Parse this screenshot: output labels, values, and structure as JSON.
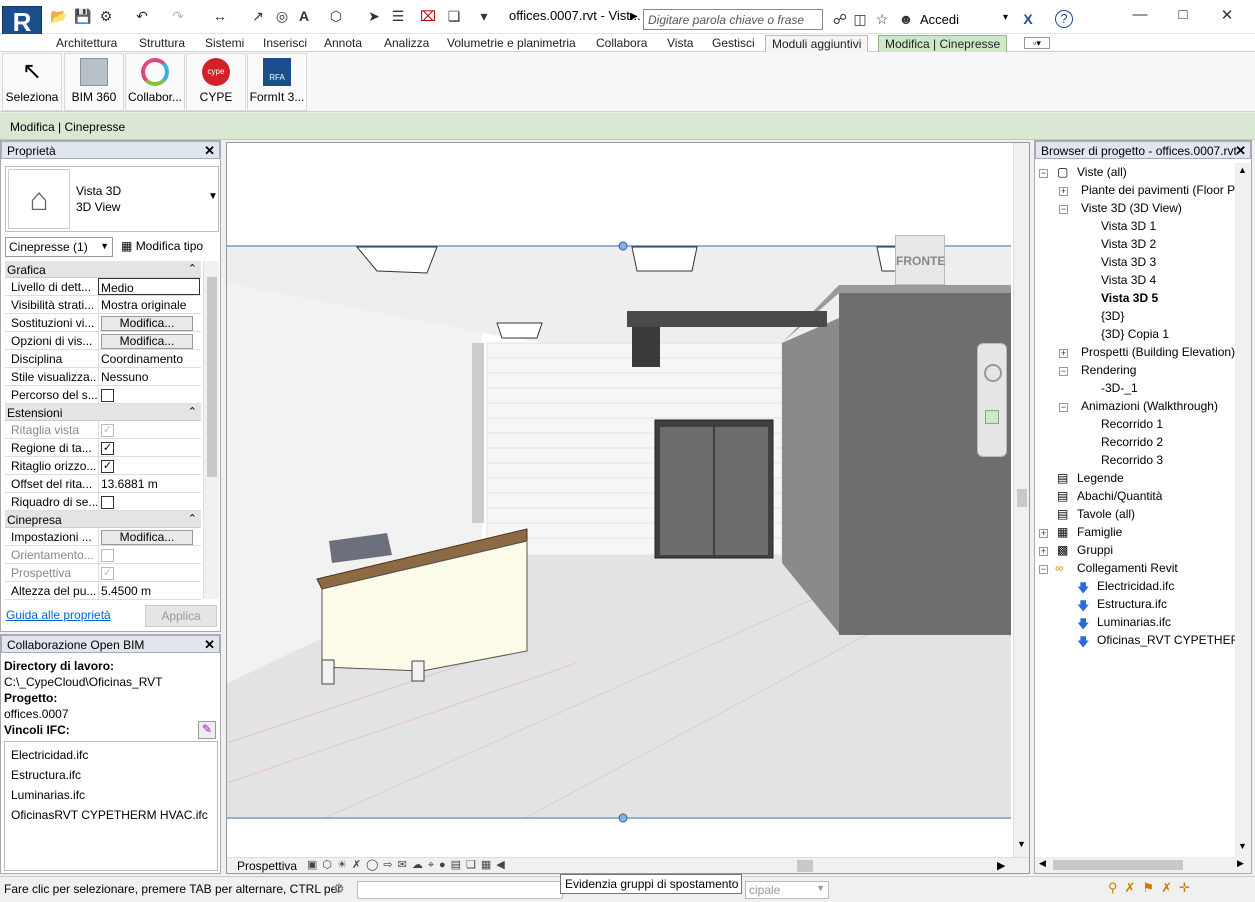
{
  "app": {
    "logo_letter": "R",
    "doc_title": "offices.0007.rvt - Vist...",
    "search_placeholder": "Digitare parola chiave o frase",
    "signin": "Accedi",
    "help": "?"
  },
  "menu": {
    "tabs": [
      "Architettura",
      "Struttura",
      "Sistemi",
      "Inserisci",
      "Annota",
      "Analizza",
      "Volumetrie e planimetria",
      "Collabora",
      "Vista",
      "Gestisci",
      "Moduli aggiuntivi",
      "Modifica | Cinepresse"
    ],
    "active": "Moduli aggiuntivi"
  },
  "ribbon": {
    "buttons": [
      "Seleziona",
      "BIM 360",
      "Collabor...",
      "CYPE",
      "FormIt 3..."
    ]
  },
  "context": {
    "label": "Modifica | Cinepresse"
  },
  "properties": {
    "title": "Proprietà",
    "type_name": "Vista 3D",
    "type_sub": "3D View",
    "selector": "Cinepresse (1)",
    "edit_type": "Modifica tipo",
    "sections": {
      "grafica": "Grafica",
      "estensioni": "Estensioni",
      "cinepresa": "Cinepresa"
    },
    "rows": {
      "livello": {
        "k": "Livello di dett...",
        "v": "Medio"
      },
      "visibilita": {
        "k": "Visibilità strati...",
        "v": "Mostra originale"
      },
      "sostituzioni": {
        "k": "Sostituzioni vi...",
        "v": "Modifica..."
      },
      "opzioni": {
        "k": "Opzioni di vis...",
        "v": "Modifica..."
      },
      "disciplina": {
        "k": "Disciplina",
        "v": "Coordinamento"
      },
      "stile": {
        "k": "Stile visualizza...",
        "v": "Nessuno"
      },
      "percorso": {
        "k": "Percorso del s..."
      },
      "ritaglia": {
        "k": "Ritaglia vista"
      },
      "regione": {
        "k": "Regione di ta..."
      },
      "ritaglio": {
        "k": "Ritaglio orizzo..."
      },
      "offset": {
        "k": "Offset del rita...",
        "v": "13.6881 m"
      },
      "riquadro": {
        "k": "Riquadro di se..."
      },
      "impostazioni": {
        "k": "Impostazioni ...",
        "v": "Modifica..."
      },
      "orientamento": {
        "k": "Orientamento..."
      },
      "prospettiva": {
        "k": "Prospettiva"
      },
      "altezza": {
        "k": "Altezza del pu...",
        "v": "5.4500 m"
      }
    },
    "help_link": "Guida alle proprietà",
    "apply": "Applica"
  },
  "openbim": {
    "title": "Collaborazione Open BIM",
    "dir_label": "Directory di lavoro:",
    "dir_value": "C:\\_CypeCloud\\Oficinas_RVT",
    "proj_label": "Progetto:",
    "proj_value": "offices.0007",
    "ifc_label": "Vincoli IFC:",
    "ifc_files": [
      "Electricidad.ifc",
      "Estructura.ifc",
      "Luminarias.ifc",
      "OficinasRVT CYPETHERM HVAC.ifc"
    ]
  },
  "viewport": {
    "viewcube_label": "FRONTE",
    "view_type": "Prospettiva"
  },
  "browser": {
    "title": "Browser di progetto - offices.0007.rvt",
    "items": {
      "viste": "Viste (all)",
      "piante": "Piante dei pavimenti (Floor Plan",
      "viste3d": "Viste 3D (3D View)",
      "v1": "Vista 3D 1",
      "v2": "Vista 3D 2",
      "v3": "Vista 3D 3",
      "v4": "Vista 3D 4",
      "v5": "Vista 3D 5",
      "v3d": "{3D}",
      "v3dcopy": "{3D} Copia 1",
      "prospetti": "Prospetti (Building Elevation)",
      "rendering": "Rendering",
      "r1": "-3D-_1",
      "animazioni": "Animazioni (Walkthrough)",
      "rec1": "Recorrido 1",
      "rec2": "Recorrido 2",
      "rec3": "Recorrido 3",
      "legende": "Legende",
      "abachi": "Abachi/Quantità",
      "tavole": "Tavole (all)",
      "famiglie": "Famiglie",
      "gruppi": "Gruppi",
      "collegamenti": "Collegamenti Revit",
      "l1": "Electricidad.ifc",
      "l2": "Estructura.ifc",
      "l3": "Luminarias.ifc",
      "l4": "Oficinas_RVT CYPETHERM HV"
    }
  },
  "status": {
    "text": "Fare clic per selezionare, premere TAB per alternare, CTRL per",
    "tooltip": "Evidenzia gruppi di spostamento",
    "model_hint": "cipale"
  },
  "colors": {
    "accent": "#1a4f8c",
    "context_green": "#d9e8d2",
    "panel_header": "#dfe6ee",
    "link": "#0066cc"
  }
}
